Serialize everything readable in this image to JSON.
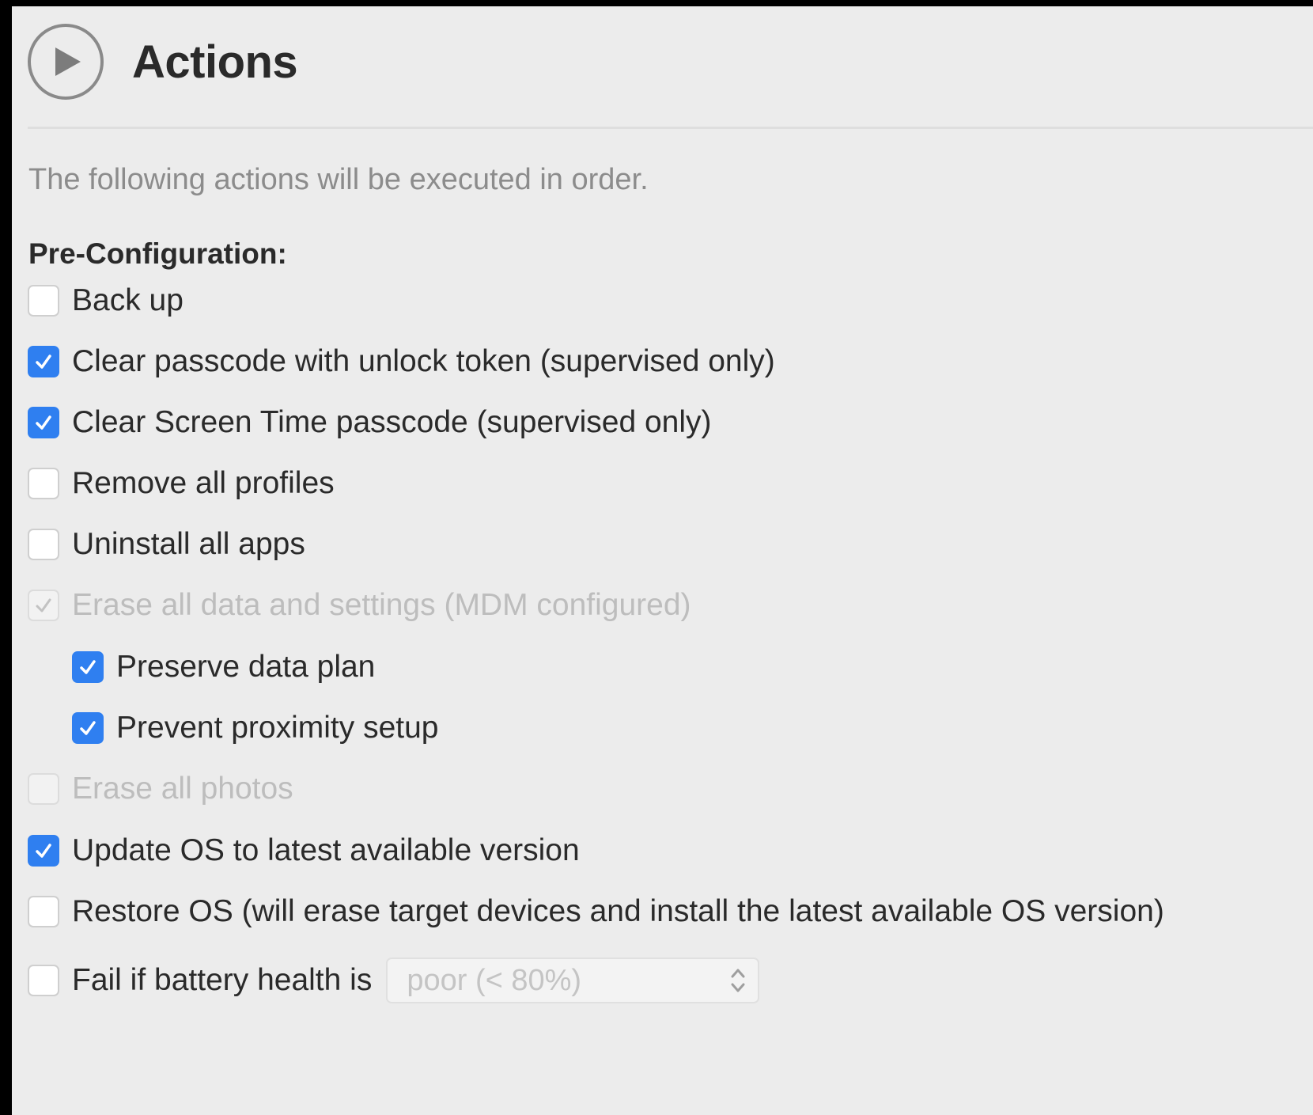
{
  "panel": {
    "title": "Actions",
    "title_icon": "play-circle-icon",
    "description": "The following actions will be executed in order.",
    "section_label": "Pre-Configuration:"
  },
  "options": [
    {
      "label": "Back up",
      "checked": false,
      "disabled": false
    },
    {
      "label": "Clear passcode with unlock token (supervised only)",
      "checked": true,
      "disabled": false
    },
    {
      "label": "Clear Screen Time passcode (supervised only)",
      "checked": true,
      "disabled": false
    },
    {
      "label": "Remove all profiles",
      "checked": false,
      "disabled": false
    },
    {
      "label": "Uninstall all apps",
      "checked": false,
      "disabled": false
    },
    {
      "label": "Erase all data and settings (MDM configured)",
      "checked": true,
      "disabled": true
    },
    {
      "label": "Preserve data plan",
      "checked": true,
      "disabled": false,
      "indent": true
    },
    {
      "label": "Prevent proximity setup",
      "checked": true,
      "disabled": false,
      "indent": true
    },
    {
      "label": "Erase all photos",
      "checked": false,
      "disabled": true
    },
    {
      "label": "Update OS to latest available version",
      "checked": true,
      "disabled": false
    },
    {
      "label": "Restore OS (will erase target devices and install the latest available OS version)",
      "checked": false,
      "disabled": false
    },
    {
      "label": "Fail if battery health is",
      "checked": false,
      "disabled": false
    }
  ],
  "battery_select": {
    "value": "poor (< 80%)",
    "icon": "chevron-up-down-icon",
    "disabled": true
  },
  "colors": {
    "panel_background": "#ececec",
    "accent": "#2f7ff0",
    "text": "#2a2a2a",
    "muted_text": "#8c8c8c",
    "disabled_text": "#bdbdbd"
  }
}
